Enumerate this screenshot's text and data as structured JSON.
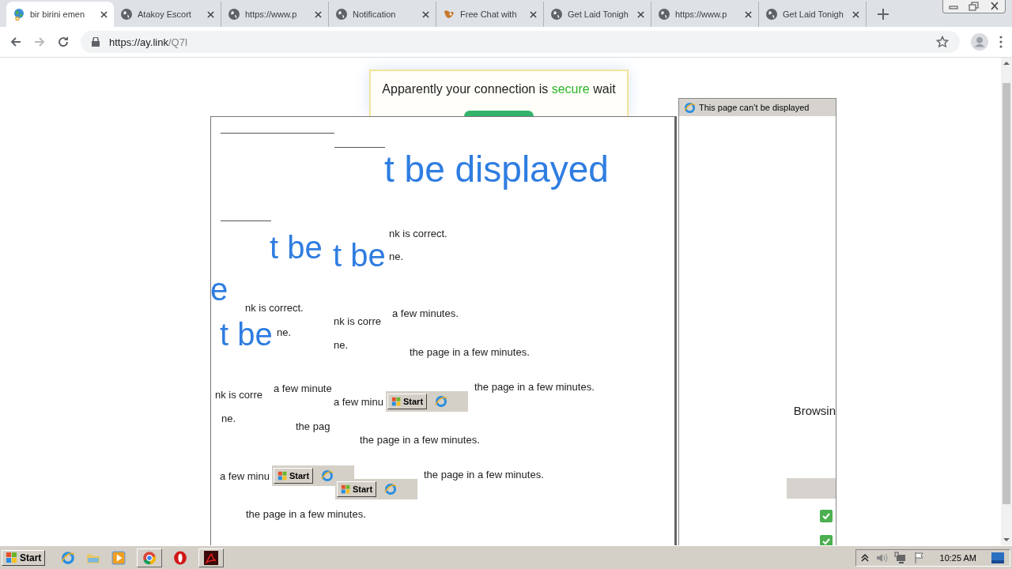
{
  "tabs": [
    {
      "title": "bir birini emen",
      "selected": true
    },
    {
      "title": "Atakoy Escort",
      "selected": false
    },
    {
      "title": "https://www.p",
      "selected": false
    },
    {
      "title": "Notification",
      "selected": false
    },
    {
      "title": "Free Chat with",
      "selected": false
    },
    {
      "title": "Get Laid Tonigh",
      "selected": false
    },
    {
      "title": "https://www.p",
      "selected": false
    },
    {
      "title": "Get Laid Tonigh",
      "selected": false
    }
  ],
  "address_bar": {
    "url_host": "https://ay.link",
    "url_path": "/Q7I"
  },
  "notice": {
    "text_before": "Apparently your connection is",
    "highlight": "secure",
    "text_after": "wait"
  },
  "side_window": {
    "title": "This page can’t be displayed",
    "fragment": "Browsin"
  },
  "fragments": [
    {
      "kind": "heading",
      "text": "t be displayed"
    },
    {
      "kind": "heading",
      "text": "t be"
    },
    {
      "kind": "heading",
      "text": "t be"
    },
    {
      "kind": "text",
      "text": "nk is correct."
    },
    {
      "kind": "text",
      "text": "ne."
    },
    {
      "kind": "heading",
      "text": "e"
    },
    {
      "kind": "text",
      "text": "nk is correct."
    },
    {
      "kind": "text",
      "text": "a few minutes."
    },
    {
      "kind": "heading",
      "text": "t be"
    },
    {
      "kind": "text",
      "text": "ne."
    },
    {
      "kind": "text",
      "text": "nk is corre"
    },
    {
      "kind": "text",
      "text": "ne."
    },
    {
      "kind": "text",
      "text": "the page in a few minutes."
    },
    {
      "kind": "text",
      "text": "nk is corre"
    },
    {
      "kind": "text",
      "text": "a few minute"
    },
    {
      "kind": "text",
      "text": "a few minu"
    },
    {
      "kind": "start",
      "text": "Start"
    },
    {
      "kind": "text",
      "text": "the page in a few minutes."
    },
    {
      "kind": "text",
      "text": "ne."
    },
    {
      "kind": "text",
      "text": "the pag"
    },
    {
      "kind": "text",
      "text": "the page in a few minutes."
    },
    {
      "kind": "text",
      "text": "a few minu"
    },
    {
      "kind": "start",
      "text": "Start"
    },
    {
      "kind": "start",
      "text": "Start"
    },
    {
      "kind": "text",
      "text": "the page in a few minutes."
    },
    {
      "kind": "text",
      "text": "the page in a few minutes."
    }
  ],
  "taskbar": {
    "start": "Start",
    "clock": "10:25 AM"
  }
}
